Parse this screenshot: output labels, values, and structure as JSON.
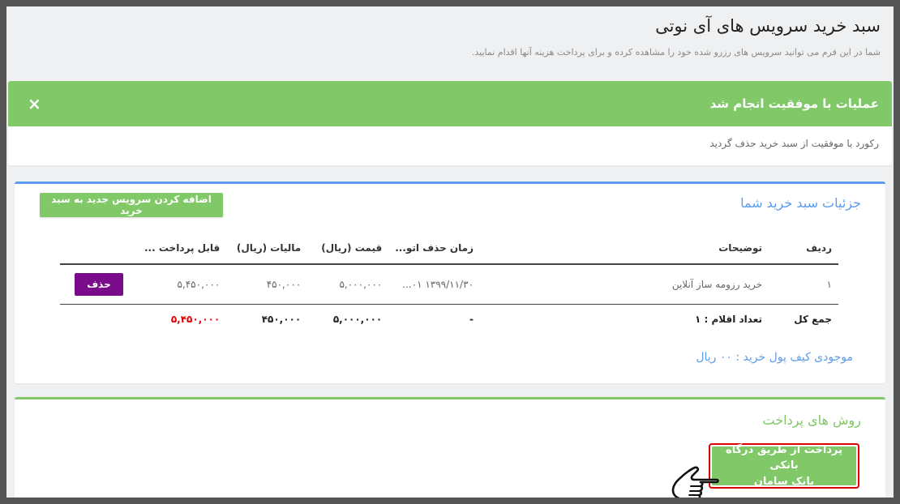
{
  "header": {
    "title": "سبد خرید سرویس های آی نوتی",
    "subtitle": "شما در این فرم می توانید سرویس های رزرو شده خود را مشاهده کرده و برای پرداخت هزینه آنها اقدام نمایید."
  },
  "alert": {
    "title": "عملیات با موفقیت انجام شد",
    "close": "×",
    "message": "رکورد با موفقیت از سبد خرید حذف گردید"
  },
  "cart": {
    "title": "جزئیات سبد خرید شما",
    "add_button": "اضافه کردن سرویس جدید به سبد خرید",
    "columns": {
      "index": "ردیف",
      "description": "توضیحات",
      "auto_delete_time": "زمان حذف اتو...",
      "price": "قیمت (ریال)",
      "tax": "مالیات (ریال)",
      "payable": "قابل پرداخت ..."
    },
    "rows": [
      {
        "index": "۱",
        "description": "خرید رزومه ساز آنلاین",
        "auto_delete_time": "۱۳۹۹/۱۱/۳۰ ۰۱...",
        "price": "۵,۰۰۰,۰۰۰",
        "tax": "۴۵۰,۰۰۰",
        "payable": "۵,۴۵۰,۰۰۰",
        "delete_label": "حذف"
      }
    ],
    "total": {
      "label": "جمع کل",
      "items_count": "تعداد اقلام : ۱",
      "auto_delete_time": "-",
      "price": "۵,۰۰۰,۰۰۰",
      "tax": "۴۵۰,۰۰۰",
      "payable": "۵,۴۵۰,۰۰۰"
    },
    "wallet": "موجودی کیف پول خرید : ۰۰ ریال"
  },
  "payment": {
    "title": "روش های پرداخت",
    "button_line1": "پرداخت از طریق درگاه بانکی",
    "button_line2": "بانک سامان",
    "pointer_icon": "hand-pointer-icon"
  },
  "colors": {
    "success": "#81c868",
    "primary": "#5d9cec",
    "delete": "#7a0b8a",
    "highlight": "#e00000",
    "payable_total": "#e10000"
  }
}
